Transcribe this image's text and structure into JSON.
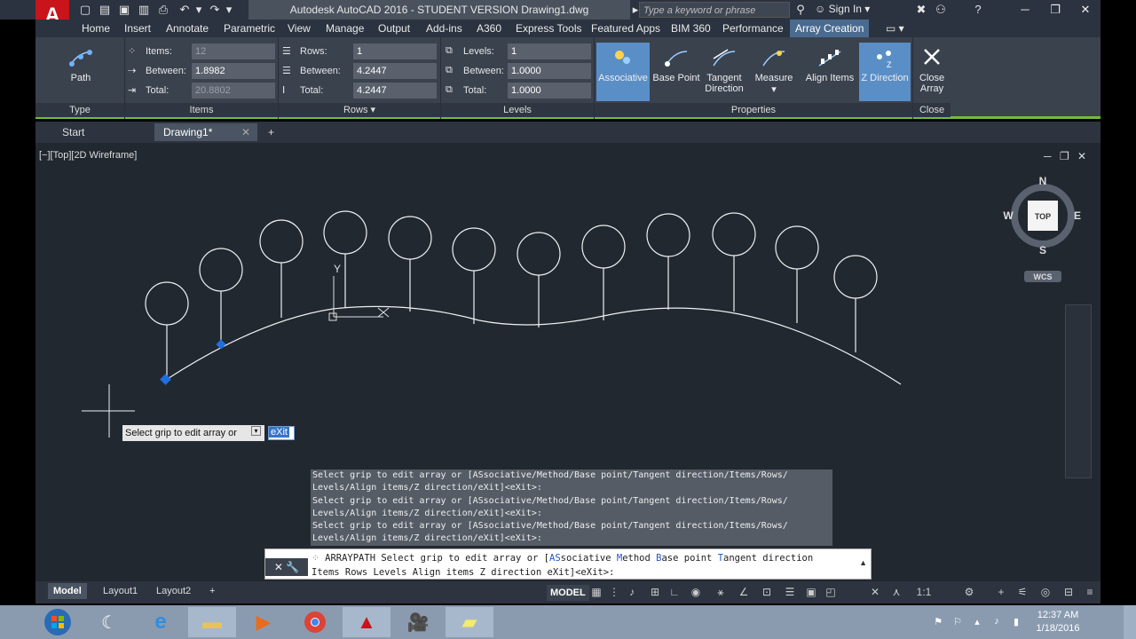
{
  "window": {
    "title": "Autodesk AutoCAD 2016 - STUDENT VERSION   Drawing1.dwg",
    "search_placeholder": "Type a keyword or phrase",
    "sign_in": "Sign In"
  },
  "menu_tabs": [
    "Home",
    "Insert",
    "Annotate",
    "Parametric",
    "View",
    "Manage",
    "Output",
    "Add-ins",
    "A360",
    "Express Tools",
    "Featured Apps",
    "BIM 360",
    "Performance",
    "Array Creation"
  ],
  "ribbon": {
    "type_panel": {
      "title": "Type",
      "button": "Path"
    },
    "items_panel": {
      "title": "Items",
      "items_label": "Items:",
      "items_value": "12",
      "between_label": "Between:",
      "between_value": "1.8982",
      "total_label": "Total:",
      "total_value": "20.8802"
    },
    "rows_panel": {
      "title": "Rows ▾",
      "rows_label": "Rows:",
      "rows_value": "1",
      "between_label": "Between:",
      "between_value": "4.2447",
      "total_label": "Total:",
      "total_value": "4.2447"
    },
    "levels_panel": {
      "title": "Levels",
      "levels_label": "Levels:",
      "levels_value": "1",
      "between_label": "Between:",
      "between_value": "1.0000",
      "total_label": "Total:",
      "total_value": "1.0000"
    },
    "properties_panel": {
      "title": "Properties",
      "associative": "Associative",
      "base_point": "Base Point",
      "tangent_direction": "Tangent Direction",
      "measure": "Measure",
      "align_items": "Align Items",
      "z_direction": "Z Direction"
    },
    "close_panel": {
      "title": "Close",
      "close_array": "Close Array"
    }
  },
  "doc_tabs": {
    "start": "Start",
    "drawing": "Drawing1*"
  },
  "viewport": {
    "label": "[−][Top][2D Wireframe]",
    "viewcube": {
      "top": "TOP",
      "n": "N",
      "s": "S",
      "e": "E",
      "w": "W",
      "wcs": "WCS"
    },
    "tooltip": "Select grip to edit array or",
    "tooltip_input": "eXit"
  },
  "command": {
    "history": [
      "Select grip to edit array or [ASsociative/Method/Base point/Tangent direction/Items/Rows/",
      "Levels/Align items/Z direction/eXit]<eXit>:",
      "Select grip to edit array or [ASsociative/Method/Base point/Tangent direction/Items/Rows/",
      "Levels/Align items/Z direction/eXit]<eXit>:",
      "Select grip to edit array or [ASsociative/Method/Base point/Tangent direction/Items/Rows/",
      "Levels/Align items/Z direction/eXit]<eXit>:"
    ],
    "current_prefix": "ARRAYPATH Select grip to edit array or [",
    "current_line2": "Items Rows Levels Align items Z direction eXit]<eXit>:"
  },
  "status": {
    "layouts": [
      "Model",
      "Layout1",
      "Layout2"
    ],
    "model": "MODEL",
    "scale": "1:1"
  },
  "taskbar": {
    "time": "12:37 AM",
    "date": "1/18/2016"
  },
  "colors": {
    "ribbon_bg": "#3a424e",
    "viewport_bg": "#212830",
    "active_tab": "#4a6b8f",
    "grip_blue": "#1e6fe0",
    "accent_green": "#6fbf3a"
  }
}
